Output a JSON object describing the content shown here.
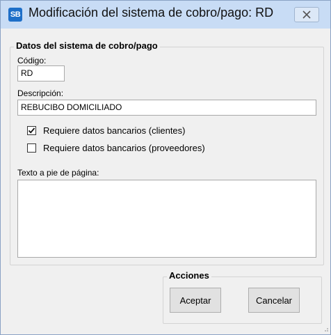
{
  "window": {
    "icon_text": "SB",
    "title": "Modificación del sistema de cobro/pago: RD"
  },
  "group_main": {
    "legend": "Datos del sistema de cobro/pago",
    "codigo_label": "Código:",
    "codigo_value": "RD",
    "descripcion_label": "Descripción:",
    "descripcion_value": "REBUCIBO DOMICILIADO",
    "checkbox_clientes_label": "Requiere datos bancarios (clientes)",
    "checkbox_clientes_checked": true,
    "checkbox_proveedores_label": "Requiere datos bancarios (proveedores)",
    "checkbox_proveedores_checked": false,
    "pie_label": "Texto a pie de página:",
    "pie_value": ""
  },
  "group_actions": {
    "legend": "Acciones",
    "accept_label": "Aceptar",
    "cancel_label": "Cancelar"
  },
  "colors": {
    "titlebar": "#c8dcf5",
    "icon_bg": "#1e6fc8",
    "window_bg": "#f0f0f0"
  }
}
